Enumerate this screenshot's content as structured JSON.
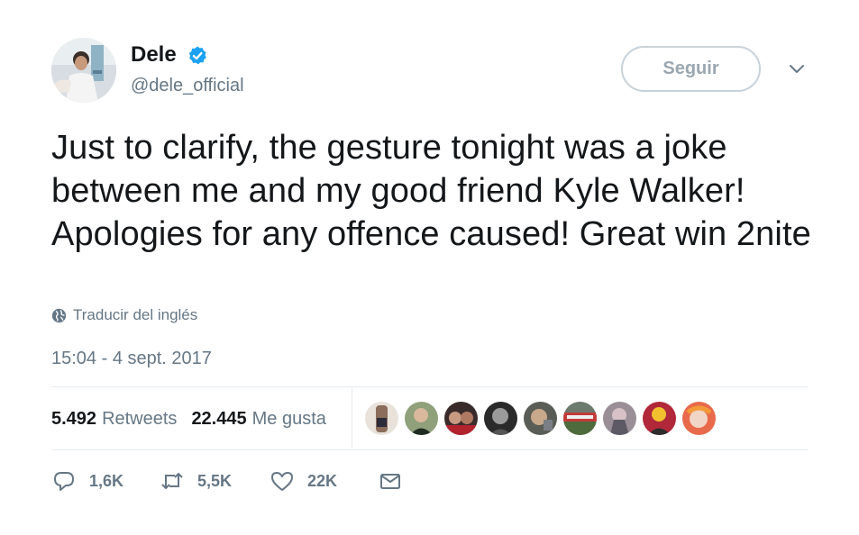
{
  "author": {
    "display_name": "Dele",
    "handle": "@dele_official",
    "verified": true,
    "avatar_icon": "profile-photo"
  },
  "follow_button": {
    "label": "Seguir"
  },
  "tweet": {
    "text": "Just to clarify, the gesture tonight was a joke between me and my good friend Kyle Walker! Apologies for any offence caused! Great win 2nite",
    "translate_label": "Traducir del inglés",
    "timestamp": "15:04 - 4 sept. 2017"
  },
  "stats": {
    "retweets_count": "5.492",
    "retweets_label": "Retweets",
    "likes_count": "22.445",
    "likes_label": "Me gusta"
  },
  "actions": {
    "replies": "1,6K",
    "retweets": "5,5K",
    "likes": "22K"
  },
  "colors": {
    "verified_blue": "#1da1f2",
    "text_primary": "#14171a",
    "text_secondary": "#657786",
    "divider": "#e6ecf0"
  }
}
